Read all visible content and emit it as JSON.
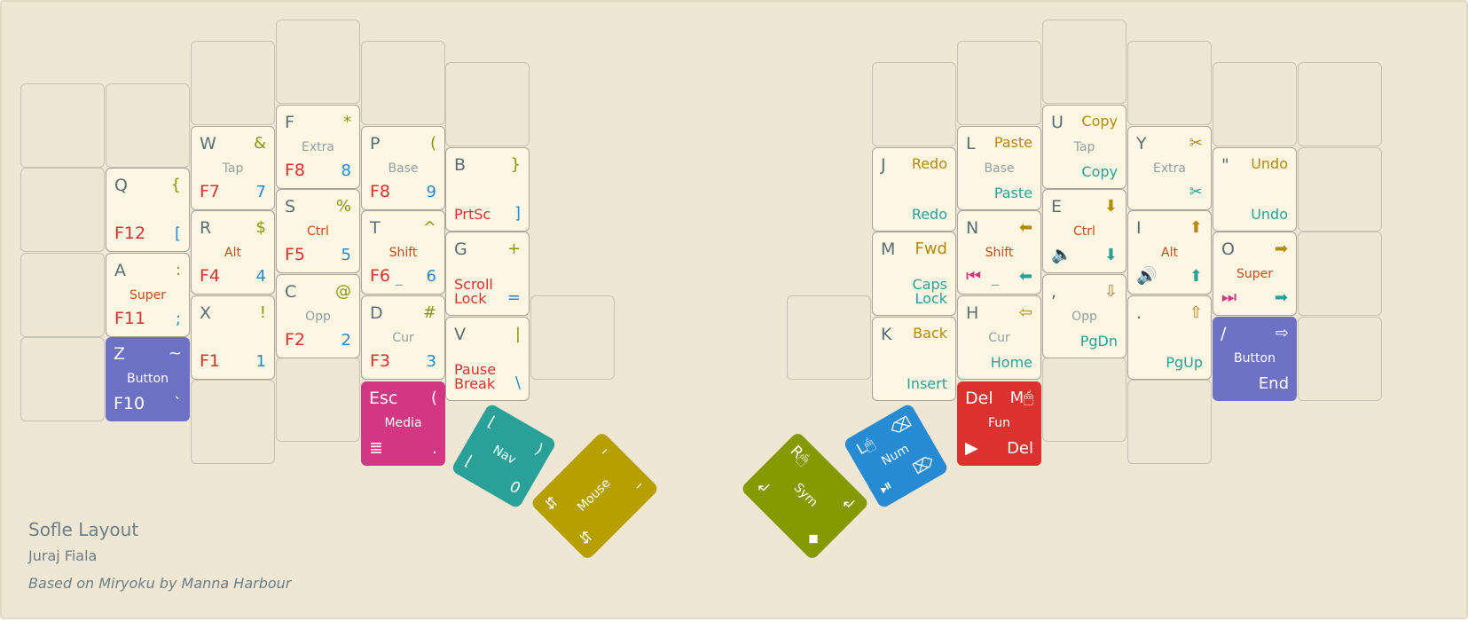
{
  "colors": {
    "base_text": "#586e75",
    "fkey": "#dc322f",
    "digit": "#268bd2",
    "symbol": "#859900",
    "sym_yellow": "#b58900",
    "mod": "#cb4b16",
    "layer_hint": "#93a1a1",
    "nav": "#2aa198",
    "nav_yellow": "#b58900",
    "media": "#d33682",
    "button_layer": "#6c71c4",
    "media_layer": "#d33682",
    "nav_layer": "#2aa198",
    "mouse_layer": "#b5a000",
    "sym_layer": "#859900",
    "num_layer": "#268bd2",
    "fun_layer": "#dc322f"
  },
  "title": {
    "name": "Sofle Layout",
    "author": "Juraj Fiala",
    "credit": "Based on Miryoku by Manna Harbour"
  },
  "keys": [
    {
      "id": "q",
      "tl": "Q",
      "tr": "{",
      "bl": "F12",
      "br": "["
    },
    {
      "id": "w",
      "tl": "W",
      "tr": "&",
      "mid": "Tap",
      "bl": "F7",
      "br": "7"
    },
    {
      "id": "f",
      "tl": "F",
      "tr": "*",
      "mid": "Extra",
      "bl": "F8",
      "br": "8"
    },
    {
      "id": "p",
      "tl": "P",
      "tr": "(",
      "mid": "Base",
      "bl": "F8",
      "br": "9"
    },
    {
      "id": "b",
      "tl": "B",
      "tr": "}",
      "bl": "PrtSc",
      "br": "]"
    },
    {
      "id": "a",
      "tl": "A",
      "tr": ":",
      "mid": "Super",
      "bl": "F11",
      "br": ";"
    },
    {
      "id": "r",
      "tl": "R",
      "tr": "$",
      "mid": "Alt",
      "bl": "F4",
      "br": "4"
    },
    {
      "id": "s",
      "tl": "S",
      "tr": "%",
      "mid": "Ctrl",
      "bl": "F5",
      "br": "5"
    },
    {
      "id": "t",
      "tl": "T",
      "tr": "^",
      "mid": "Shift",
      "bl": "F6",
      "bm": "_",
      "br": "6"
    },
    {
      "id": "g",
      "tl": "G",
      "tr": "+",
      "bl": "Scroll\nLock",
      "br": "="
    },
    {
      "id": "z",
      "tl": "Z",
      "tr": "~",
      "mid": "Button",
      "bl": "F10",
      "br": "`"
    },
    {
      "id": "x",
      "tl": "X",
      "tr": "!",
      "bl": "F1",
      "br": "1"
    },
    {
      "id": "c",
      "tl": "C",
      "tr": "@",
      "mid": "Opp",
      "bl": "F2",
      "br": "2"
    },
    {
      "id": "d",
      "tl": "D",
      "tr": "#",
      "mid": "Cur",
      "bl": "F3",
      "br": "3"
    },
    {
      "id": "v",
      "tl": "V",
      "tr": "|",
      "bl": "Pause\nBreak",
      "br": "\\"
    },
    {
      "id": "esc",
      "tl": "Esc",
      "tr": "(",
      "mid": "Media",
      "bl": "≣",
      "br": "."
    },
    {
      "id": "j",
      "tl": "J",
      "tr": "Redo",
      "br": "Redo"
    },
    {
      "id": "l",
      "tl": "L",
      "tr": "Paste",
      "mid": "Base",
      "br": "Paste"
    },
    {
      "id": "u",
      "tl": "U",
      "tr": "Copy",
      "mid": "Tap",
      "br": "Copy"
    },
    {
      "id": "y",
      "tl": "Y",
      "tr": "✂",
      "mid": "Extra",
      "br": "✂"
    },
    {
      "id": "quote",
      "tl": "\"",
      "tr": "Undo",
      "br": "Undo"
    },
    {
      "id": "m",
      "tl": "M",
      "tr": "Fwd",
      "br": "Caps\nLock"
    },
    {
      "id": "n",
      "tl": "N",
      "tr": "⬅",
      "mid": "Shift",
      "bl": "⏮",
      "bm": "_",
      "br": "⬅"
    },
    {
      "id": "e",
      "tl": "E",
      "tr": "⬇",
      "mid": "Ctrl",
      "bl": "🔈",
      "br": "⬇"
    },
    {
      "id": "i",
      "tl": "I",
      "tr": "⬆",
      "mid": "Alt",
      "bl": "🔊",
      "br": "⬆"
    },
    {
      "id": "o",
      "tl": "O",
      "tr": "➡",
      "mid": "Super",
      "bl": "⏭",
      "br": "➡"
    },
    {
      "id": "k",
      "tl": "K",
      "tr": "Back",
      "br": "Insert"
    },
    {
      "id": "h",
      "tl": "H",
      "tr": "⇦",
      "mid": "Cur",
      "br": "Home"
    },
    {
      "id": "comma",
      "tl": ",",
      "tr": "⇩",
      "mid": "Opp",
      "br": "PgDn"
    },
    {
      "id": "dot",
      "tl": ".",
      "tr": "⇧",
      "br": "PgUp"
    },
    {
      "id": "slash",
      "tl": "/",
      "tr": "⇨",
      "mid": "Button",
      "br": "End"
    },
    {
      "id": "del",
      "tl": "Del",
      "tr": "M🖱",
      "mid": "Fun",
      "bl": "▶",
      "br": "Del"
    }
  ],
  "thumbs": [
    {
      "id": "nav",
      "name": "Nav",
      "tl": "⌊",
      "tr": ")",
      "bl": "⌊",
      "br": "0"
    },
    {
      "id": "mouse",
      "name": "Mouse",
      "tl": "⇵",
      "tr": "–",
      "bl": "⇵",
      "br": "–"
    },
    {
      "id": "sym",
      "name": "Sym",
      "tl": "R🖱",
      "tr": "↲",
      "bl": "↲",
      "br": "◆"
    },
    {
      "id": "num",
      "name": "Num",
      "tl": "L🖱",
      "tr": "⌫",
      "bl": "⏯",
      "br": "⌦"
    }
  ]
}
